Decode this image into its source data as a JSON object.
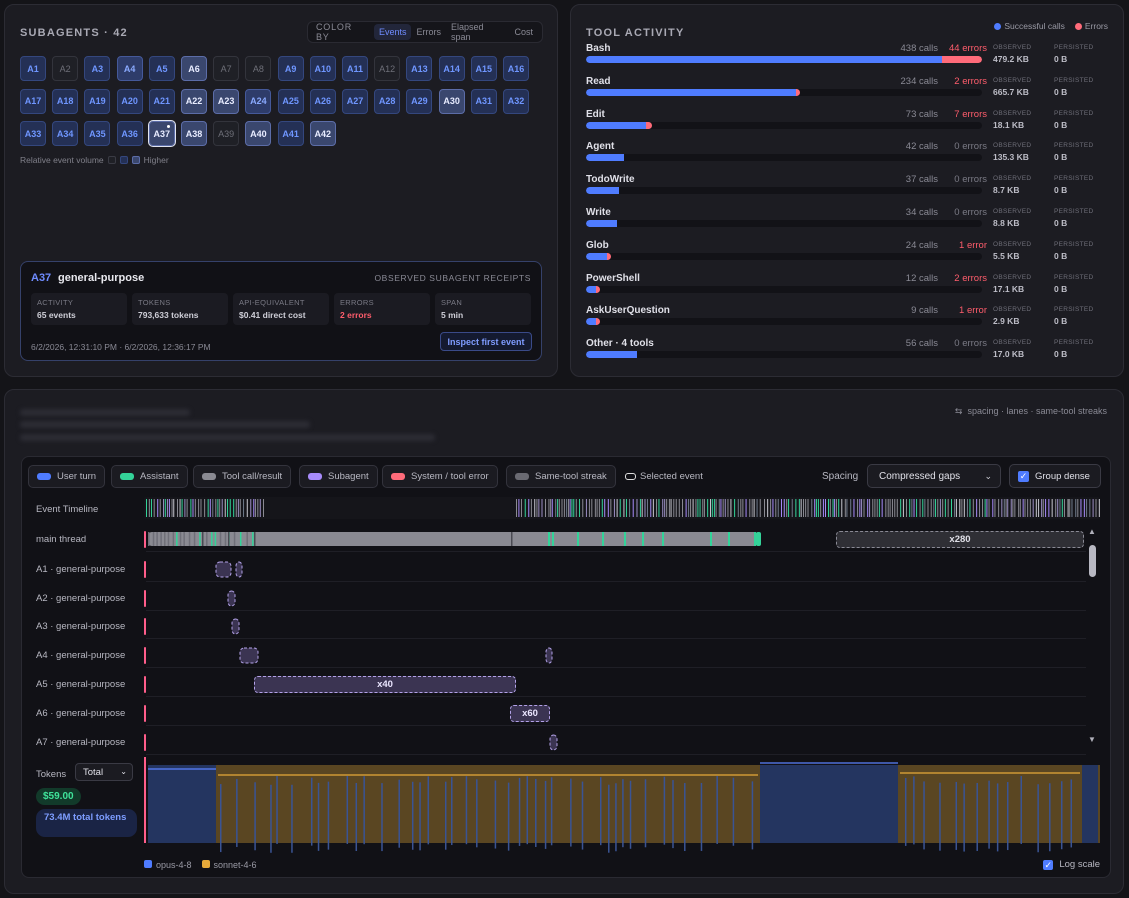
{
  "subagents": {
    "title": "SUBAGENTS · 42",
    "color_by": {
      "label": "COLOR BY",
      "options": [
        "Events",
        "Errors",
        "Elapsed span",
        "Cost"
      ],
      "selected": "Events"
    },
    "agents": [
      {
        "id": "A1",
        "level": 1
      },
      {
        "id": "A2",
        "level": 0
      },
      {
        "id": "A3",
        "level": 1
      },
      {
        "id": "A4",
        "level": 2
      },
      {
        "id": "A5",
        "level": 1
      },
      {
        "id": "A6",
        "level": 3
      },
      {
        "id": "A7",
        "level": 0
      },
      {
        "id": "A8",
        "level": 0
      },
      {
        "id": "A9",
        "level": 1
      },
      {
        "id": "A10",
        "level": 1
      },
      {
        "id": "A11",
        "level": 1
      },
      {
        "id": "A12",
        "level": 0
      },
      {
        "id": "A13",
        "level": 1
      },
      {
        "id": "A14",
        "level": 1
      },
      {
        "id": "A15",
        "level": 1
      },
      {
        "id": "A16",
        "level": 1
      },
      {
        "id": "A17",
        "level": 1
      },
      {
        "id": "A18",
        "level": 1
      },
      {
        "id": "A19",
        "level": 1
      },
      {
        "id": "A20",
        "level": 1
      },
      {
        "id": "A21",
        "level": 1
      },
      {
        "id": "A22",
        "level": 3
      },
      {
        "id": "A23",
        "level": 3
      },
      {
        "id": "A24",
        "level": 2
      },
      {
        "id": "A25",
        "level": 1
      },
      {
        "id": "A26",
        "level": 1
      },
      {
        "id": "A27",
        "level": 1
      },
      {
        "id": "A28",
        "level": 1
      },
      {
        "id": "A29",
        "level": 1
      },
      {
        "id": "A30",
        "level": 3
      },
      {
        "id": "A31",
        "level": 1
      },
      {
        "id": "A32",
        "level": 1
      },
      {
        "id": "A33",
        "level": 1
      },
      {
        "id": "A34",
        "level": 1
      },
      {
        "id": "A35",
        "level": 1
      },
      {
        "id": "A36",
        "level": 1
      },
      {
        "id": "A37",
        "level": 3,
        "selected": true
      },
      {
        "id": "A38",
        "level": 3
      },
      {
        "id": "A39",
        "level": 0
      },
      {
        "id": "A40",
        "level": 3
      },
      {
        "id": "A41",
        "level": 1
      },
      {
        "id": "A42",
        "level": 3
      }
    ],
    "legend": {
      "label": "Relative event volume",
      "higher": "Higher"
    },
    "receipt": {
      "id": "A37",
      "name": "general-purpose",
      "tag": "OBSERVED SUBAGENT RECEIPTS",
      "stats": [
        {
          "label": "ACTIVITY",
          "value": "65 events",
          "error": false
        },
        {
          "label": "TOKENS",
          "value": "793,633 tokens",
          "error": false
        },
        {
          "label": "API-EQUIVALENT",
          "value": "$0.41 direct cost",
          "error": false
        },
        {
          "label": "ERRORS",
          "value": "2 errors",
          "error": true
        },
        {
          "label": "SPAN",
          "value": "5 min",
          "error": false
        }
      ],
      "time_range": "6/2/2026, 12:31:10 PM · 6/2/2026, 12:36:17 PM",
      "inspect_label": "Inspect first event"
    }
  },
  "tools": {
    "title": "TOOL ACTIVITY",
    "legend_success": "Successful calls",
    "legend_errors": "Errors",
    "colors": {
      "success": "#4f7cff",
      "error": "#ff6b7a"
    },
    "observed_label": "OBSERVED",
    "persisted_label": "PERSISTED",
    "max_calls": 438,
    "items": [
      {
        "name": "Bash",
        "calls": 438,
        "calls_label": "438 calls",
        "errors": 44,
        "errors_label": "44 errors",
        "observed": "479.2 KB",
        "persisted": "0 B"
      },
      {
        "name": "Read",
        "calls": 234,
        "calls_label": "234 calls",
        "errors": 2,
        "errors_label": "2 errors",
        "observed": "665.7 KB",
        "persisted": "0 B"
      },
      {
        "name": "Edit",
        "calls": 73,
        "calls_label": "73 calls",
        "errors": 7,
        "errors_label": "7 errors",
        "observed": "18.1 KB",
        "persisted": "0 B"
      },
      {
        "name": "Agent",
        "calls": 42,
        "calls_label": "42 calls",
        "errors": 0,
        "errors_label": "0 errors",
        "observed": "135.3 KB",
        "persisted": "0 B"
      },
      {
        "name": "TodoWrite",
        "calls": 37,
        "calls_label": "37 calls",
        "errors": 0,
        "errors_label": "0 errors",
        "observed": "8.7 KB",
        "persisted": "0 B"
      },
      {
        "name": "Write",
        "calls": 34,
        "calls_label": "34 calls",
        "errors": 0,
        "errors_label": "0 errors",
        "observed": "8.8 KB",
        "persisted": "0 B"
      },
      {
        "name": "Glob",
        "calls": 24,
        "calls_label": "24 calls",
        "errors": 1,
        "errors_label": "1 error",
        "observed": "5.5 KB",
        "persisted": "0 B"
      },
      {
        "name": "PowerShell",
        "calls": 12,
        "calls_label": "12 calls",
        "errors": 2,
        "errors_label": "2 errors",
        "observed": "17.1 KB",
        "persisted": "0 B"
      },
      {
        "name": "AskUserQuestion",
        "calls": 9,
        "calls_label": "9 calls",
        "errors": 1,
        "errors_label": "1 error",
        "observed": "2.9 KB",
        "persisted": "0 B"
      },
      {
        "name": "Other · 4 tools",
        "calls": 56,
        "calls_label": "56 calls",
        "errors": 0,
        "errors_label": "0 errors",
        "observed": "17.0 KB",
        "persisted": "0 B"
      }
    ]
  },
  "timeline": {
    "header_right": "spacing · lanes · same-tool streaks",
    "legend": [
      {
        "label": "User turn",
        "color": "#4f7cff"
      },
      {
        "label": "Assistant",
        "color": "#34d399"
      },
      {
        "label": "Tool call/result",
        "color": "#8a8a92"
      },
      {
        "label": "Subagent",
        "color": "#a78bfa"
      },
      {
        "label": "System / tool error",
        "color": "#ff6b7a"
      },
      {
        "label": "Same-tool streak",
        "color": "#6a6a72"
      }
    ],
    "selected_event_label": "Selected event",
    "spacing_label": "Spacing",
    "spacing_value": "Compressed gaps",
    "group_dense_label": "Group dense",
    "event_timeline_label": "Event Timeline",
    "main_thread_label": "main thread",
    "main_streak_label": "x280",
    "lanes": [
      {
        "label": "A1 · general-purpose"
      },
      {
        "label": "A2 · general-purpose"
      },
      {
        "label": "A3 · general-purpose"
      },
      {
        "label": "A4 · general-purpose"
      },
      {
        "label": "A5 · general-purpose",
        "streak": "x40"
      },
      {
        "label": "A6 · general-purpose",
        "streak": "x60"
      },
      {
        "label": "A7 · general-purpose"
      }
    ],
    "tokens_label": "Tokens",
    "tokens_mode": "Total",
    "cost": "$59.00",
    "total_tokens": "73.4M total tokens",
    "models": [
      {
        "name": "opus-4-8",
        "color": "#4f7cff"
      },
      {
        "name": "sonnet-4-6",
        "color": "#e6a93a"
      }
    ],
    "log_scale_label": "Log scale"
  }
}
